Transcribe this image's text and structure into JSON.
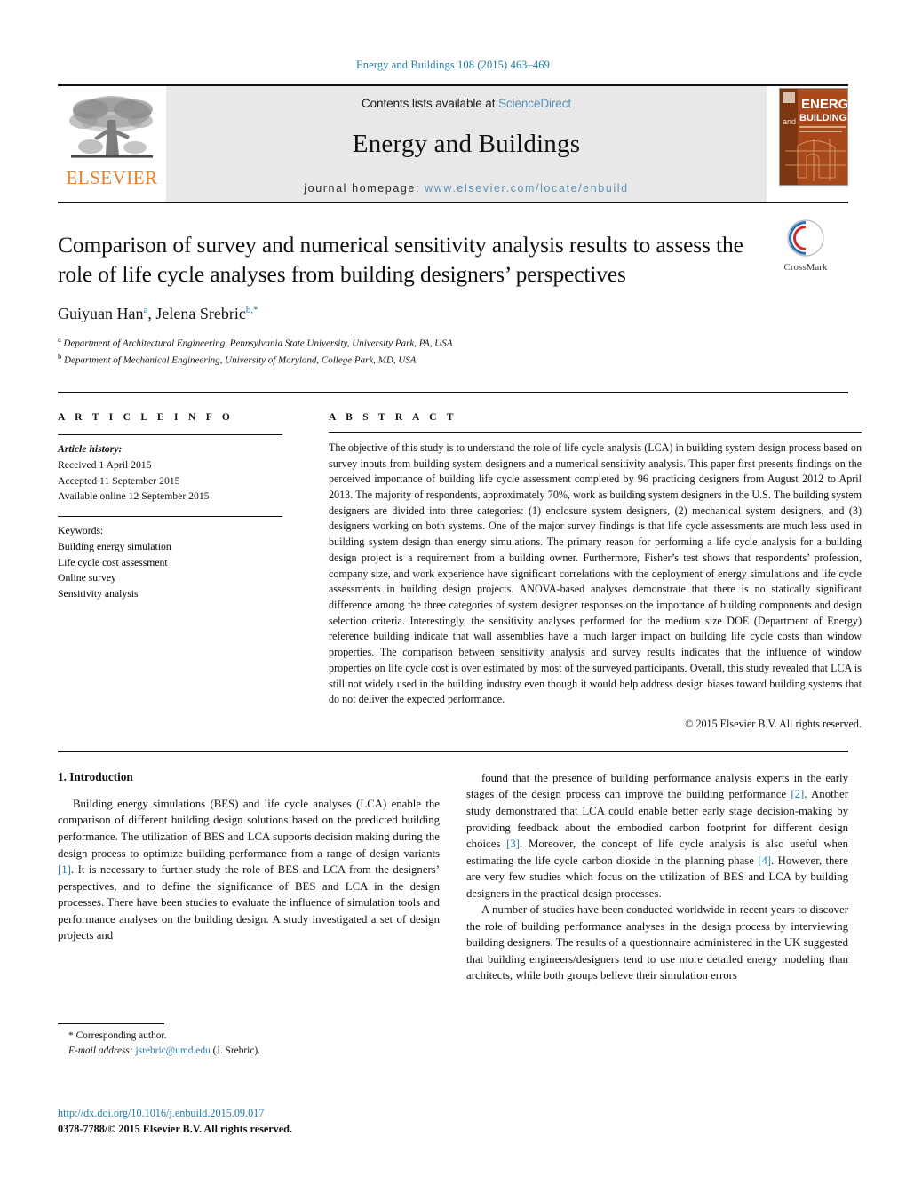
{
  "running_head": "Energy and Buildings 108 (2015) 463–469",
  "masthead": {
    "publisher_logo_name": "elsevier-tree-logo",
    "publisher_wordmark": "ELSEVIER",
    "contents_prefix": "Contents lists available at ",
    "contents_link": "ScienceDirect",
    "journal_title": "Energy and Buildings",
    "homepage_prefix": "journal homepage:",
    "homepage_url": "www.elsevier.com/locate/enbuild",
    "cover_title_top": "ENERGY",
    "cover_title_bottom": "BUILDINGS",
    "cover_and": "and"
  },
  "article": {
    "title": "Comparison of survey and numerical sensitivity analysis results to assess the role of life cycle analyses from building designers’ perspectives",
    "crossmark_label": "CrossMark",
    "authors_html": "Guiyuan Han<sup>a</sup>, Jelena Srebric<sup>b,</sup><sup>*</sup>",
    "affiliation_a": "Department of Architectural Engineering, Pennsylvania State University, University Park, PA, USA",
    "affiliation_b": "Department of Mechanical Engineering, University of Maryland, College Park, MD, USA"
  },
  "article_info": {
    "heading": "A R T I C L E   I N F O",
    "history_label": "Article history:",
    "history": [
      "Received 1 April 2015",
      "Accepted 11 September 2015",
      "Available online 12 September 2015"
    ],
    "keywords_label": "Keywords:",
    "keywords": [
      "Building energy simulation",
      "Life cycle cost assessment",
      "Online survey",
      "Sensitivity analysis"
    ]
  },
  "abstract": {
    "heading": "A B S T R A C T",
    "text": "The objective of this study is to understand the role of life cycle analysis (LCA) in building system design process based on survey inputs from building system designers and a numerical sensitivity analysis. This paper first presents findings on the perceived importance of building life cycle assessment completed by 96 practicing designers from August 2012 to April 2013. The majority of respondents, approximately 70%, work as building system designers in the U.S. The building system designers are divided into three categories: (1) enclosure system designers, (2) mechanical system designers, and (3) designers working on both systems. One of the major survey findings is that life cycle assessments are much less used in building system design than energy simulations. The primary reason for performing a life cycle analysis for a building design project is a requirement from a building owner. Furthermore, Fisher’s test shows that respondents’ profession, company size, and work experience have significant correlations with the deployment of energy simulations and life cycle assessments in building design projects. ANOVA-based analyses demonstrate that there is no statically significant difference among the three categories of system designer responses on the importance of building components and design selection criteria. Interestingly, the sensitivity analyses performed for the medium size DOE (Department of Energy) reference building indicate that wall assemblies have a much larger impact on building life cycle costs than window properties. The comparison between sensitivity analysis and survey results indicates that the influence of window properties on life cycle cost is over estimated by most of the surveyed participants. Overall, this study revealed that LCA is still not widely used in the building industry even though it would help address design biases toward building systems that do not deliver the expected performance.",
    "copyright": "© 2015 Elsevier B.V. All rights reserved."
  },
  "introduction": {
    "heading": "1.  Introduction",
    "left_paragraphs": [
      "Building energy simulations (BES) and life cycle analyses (LCA) enable the comparison of different building design solutions based on the predicted building performance. The utilization of BES and LCA supports decision making during the design process to optimize building performance from a range of design variants [1]. It is necessary to further study the role of BES and LCA from the designers’ perspectives, and to define the significance of BES and LCA in the design processes. There have been studies to evaluate the influence of simulation tools and performance analyses on the building design. A study investigated a set of design projects and"
    ],
    "right_paragraphs": [
      "found that the presence of building performance analysis experts in the early stages of the design process can improve the building performance [2]. Another study demonstrated that LCA could enable better early stage decision-making by providing feedback about the embodied carbon footprint for different design choices [3]. Moreover, the concept of life cycle analysis is also useful when estimating the life cycle carbon dioxide in the planning phase [4]. However, there are very few studies which focus on the utilization of BES and LCA by building designers in the practical design processes.",
      "A number of studies have been conducted worldwide in recent years to discover the role of building performance analyses in the design process by interviewing building designers. The results of a questionnaire administered in the UK suggested that building engineers/designers tend to use more detailed energy modeling than architects, while both groups believe their simulation errors"
    ]
  },
  "footer": {
    "corresponding_marker": "*",
    "corresponding_label": "Corresponding author.",
    "email_label": "E-mail address:",
    "email": "jsrebric@umd.edu",
    "email_suffix": "(J. Srebric).",
    "doi_url": "http://dx.doi.org/10.1016/j.enbuild.2015.09.017",
    "issn_line": "0378-7788/© 2015 Elsevier B.V. All rights reserved."
  },
  "colors": {
    "link_blue": "#1f7ba6",
    "sciencedirect_blue": "#5b91b4",
    "elsevier_orange": "#ef7d22",
    "band_gray": "#e8e8e8",
    "cover_orange": "#b5531f"
  }
}
